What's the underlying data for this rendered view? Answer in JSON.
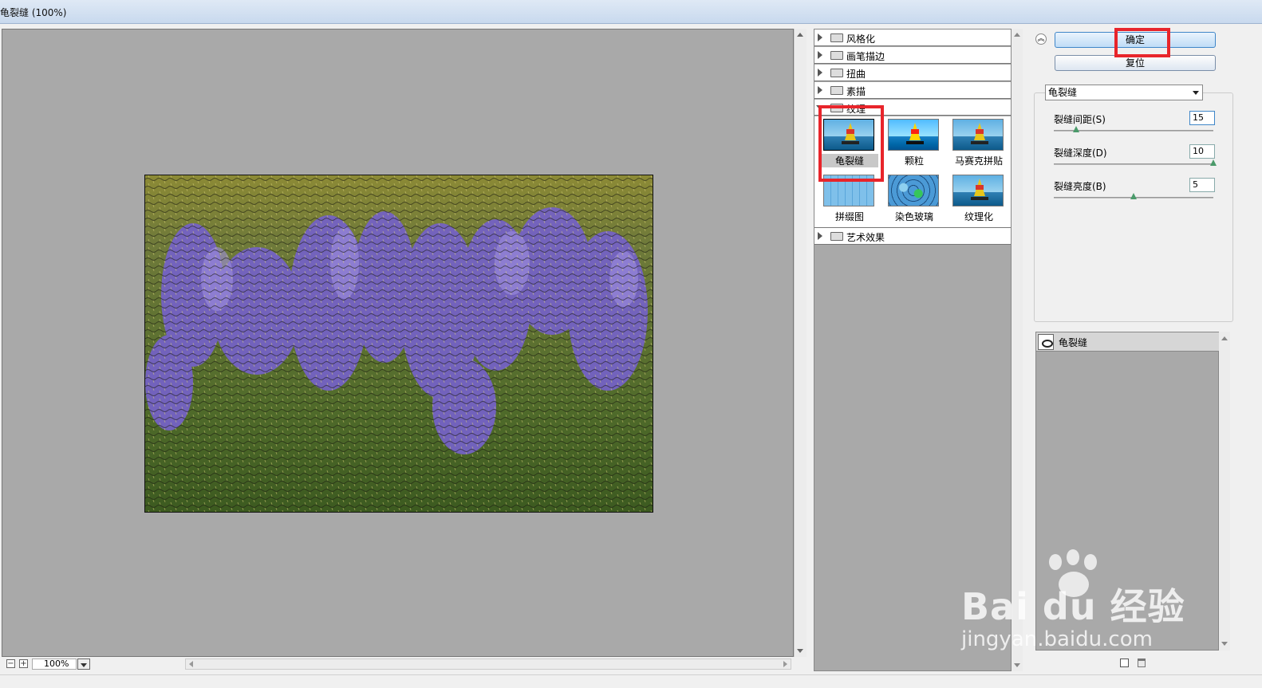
{
  "window": {
    "title": "龟裂缝 (100%)"
  },
  "zoom": {
    "value": "100%"
  },
  "gallery": {
    "categories_top": [
      "风格化",
      "画笔描边",
      "扭曲",
      "素描"
    ],
    "texture_category": "纹理",
    "thumbnails": [
      "龟裂缝",
      "颗粒",
      "马赛克拼贴",
      "拼缀图",
      "染色玻璃",
      "纹理化"
    ],
    "selected_thumbnail": "龟裂缝",
    "categories_bottom": [
      "艺术效果"
    ]
  },
  "buttons": {
    "ok": "确定",
    "reset": "复位"
  },
  "filter_select": {
    "value": "龟裂缝"
  },
  "params": [
    {
      "label": "裂缝间距(S)",
      "value": "15"
    },
    {
      "label": "裂缝深度(D)",
      "value": "10"
    },
    {
      "label": "裂缝亮度(B)",
      "value": "5"
    }
  ],
  "layers": {
    "items": [
      "龟裂缝"
    ]
  },
  "watermark": {
    "brand": "Bai du 经验",
    "url": "jingyan.baidu.com"
  },
  "colors": {
    "highlight": "#e8252b",
    "canvas_bg": "#a9a9a9"
  }
}
